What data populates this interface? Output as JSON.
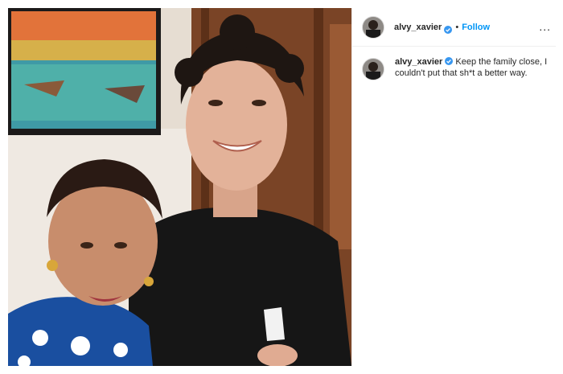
{
  "post": {
    "username": "alvy_xavier",
    "follow_label": "Follow",
    "dot": "•",
    "more_label": "...",
    "caption": "Keep the family close, I couldn't put that sh*t a better way."
  },
  "icons": {
    "verified": "verified-badge-icon",
    "more": "more-options-icon"
  },
  "colors": {
    "link_blue": "#0095f6",
    "text": "#262626",
    "border": "#efefef"
  }
}
